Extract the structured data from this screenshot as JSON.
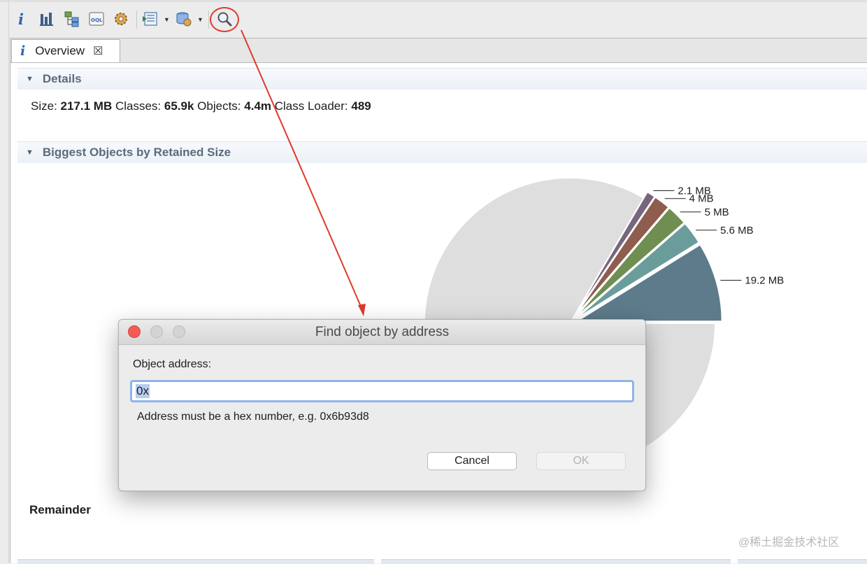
{
  "toolbar": {
    "icons": [
      "info-icon",
      "histogram-icon",
      "dominator-tree-icon",
      "oql-icon",
      "thread-overview-icon",
      "query-browser-icon",
      "heap-dump-icon",
      "find-object-icon"
    ]
  },
  "tab": {
    "label": "Overview"
  },
  "details": {
    "title": "Details",
    "size_label": "Size:",
    "size_value": "217.1 MB",
    "classes_label": "Classes:",
    "classes_value": "65.9k",
    "objects_label": "Objects:",
    "objects_value": "4.4m",
    "classloader_label": "Class Loader:",
    "classloader_value": "489"
  },
  "biggest": {
    "title": "Biggest Objects by Retained Size",
    "remainder_label": "Remainder"
  },
  "chart_data": {
    "type": "pie",
    "title": "",
    "unit": "MB",
    "slices": [
      {
        "label": "19.2 MB",
        "value": 19.2,
        "color": "#5d7b8a"
      },
      {
        "label": "5.6 MB",
        "value": 5.6,
        "color": "#6b9c9c"
      },
      {
        "label": "5 MB",
        "value": 5.0,
        "color": "#6f8e51"
      },
      {
        "label": "4 MB",
        "value": 4.0,
        "color": "#8e5d4e"
      },
      {
        "label": "2.1 MB",
        "value": 2.1,
        "color": "#77667d"
      },
      {
        "label": "Remainder",
        "value": 181.2,
        "color": "#dedede"
      }
    ]
  },
  "dialog": {
    "title": "Find object by address",
    "field_label": "Object address:",
    "input_value": "0x",
    "hint": "Address must be a hex number, e.g. 0x6b93d8",
    "cancel_label": "Cancel",
    "ok_label": "OK"
  },
  "watermark": "@稀土掘金技术社区",
  "colors": {
    "annotation": "#e0392b",
    "input_focus": "#8fb4e8",
    "section_title": "#5a6b7d"
  }
}
